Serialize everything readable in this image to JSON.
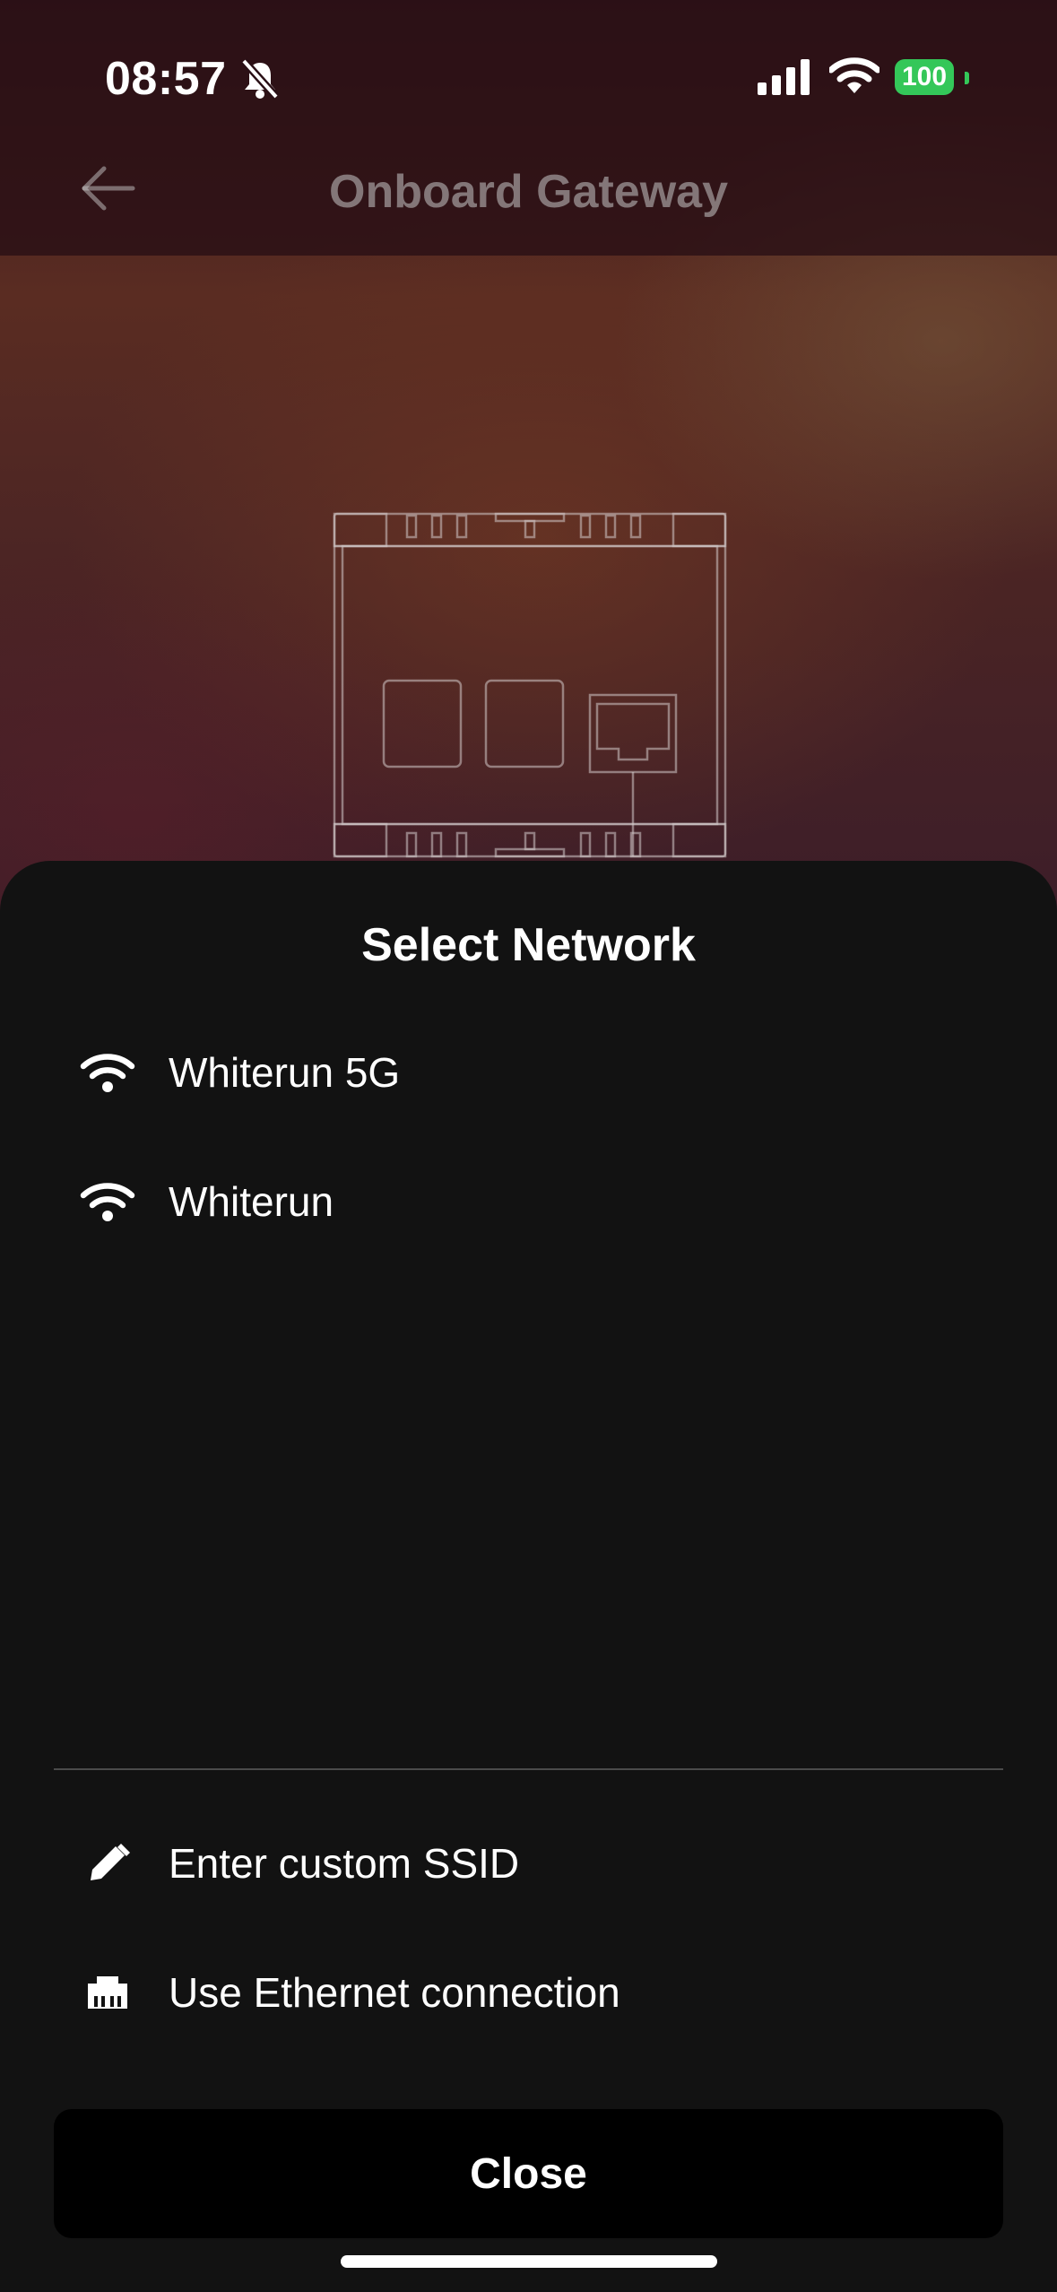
{
  "status_bar": {
    "time": "08:57",
    "battery": "100"
  },
  "nav": {
    "title": "Onboard Gateway"
  },
  "sheet": {
    "title": "Select Network",
    "networks": [
      {
        "icon": "wifi-icon",
        "label": "Whiterun 5G"
      },
      {
        "icon": "wifi-icon",
        "label": "Whiterun"
      }
    ],
    "options": [
      {
        "icon": "pencil-icon",
        "label": "Enter custom SSID"
      },
      {
        "icon": "ethernet-icon",
        "label": "Use Ethernet connection"
      }
    ],
    "close_label": "Close"
  },
  "colors": {
    "battery": "#34c759",
    "sheet_bg": "#121212",
    "button_bg": "#000000"
  }
}
